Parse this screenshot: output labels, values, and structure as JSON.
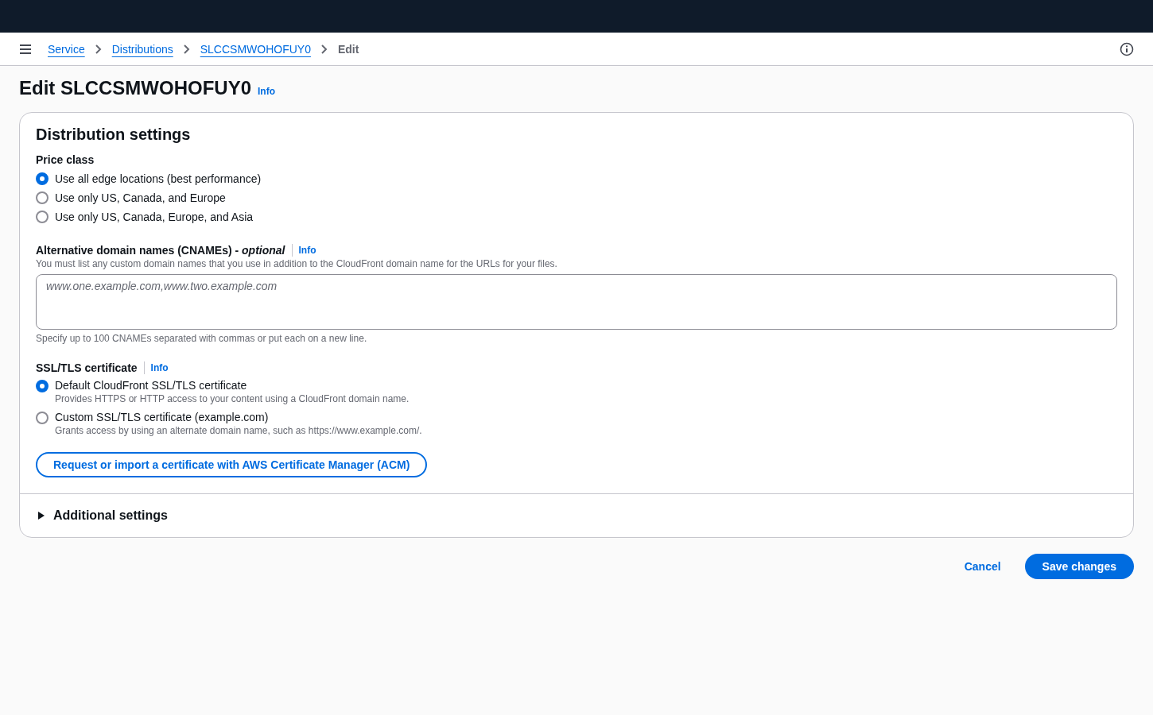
{
  "breadcrumbs": [
    {
      "label": "Service",
      "kind": "link"
    },
    {
      "label": "Distributions",
      "kind": "link"
    },
    {
      "label": "SLCCSMWOHOFUY0",
      "kind": "link"
    },
    {
      "label": "Edit",
      "kind": "current"
    }
  ],
  "page": {
    "title": "Edit SLCCSMWOHOFUY0",
    "info": "Info"
  },
  "panel": {
    "title": "Distribution settings",
    "price_class": {
      "label": "Price class",
      "options": [
        {
          "label": "Use all edge locations (best performance)",
          "selected": true
        },
        {
          "label": "Use only US, Canada, and Europe",
          "selected": false
        },
        {
          "label": "Use only US, Canada, Europe, and Asia",
          "selected": false
        }
      ]
    },
    "cnames": {
      "label": "Alternative domain names (CNAMEs) - *optional*",
      "info": "Info",
      "description": "You must list any custom domain names that you use in addition to the CloudFront domain name for the URLs for your files.",
      "placeholder": "www.one.example.com,www.two.example.com",
      "hint": "Specify up to 100 CNAMEs separated with commas or put each on a new line."
    },
    "certificate": {
      "label": "SSL/TLS certificate",
      "info": "Info",
      "options": [
        {
          "label": "Default CloudFront SSL/TLS certificate",
          "description": "Provides HTTPS or HTTP access to your content using a CloudFront domain name.",
          "selected": true
        },
        {
          "label": "Custom SSL/TLS certificate (example.com)",
          "description": "Grants access by using an alternate domain name, such as https://www.example.com/.",
          "selected": false
        }
      ],
      "button": "Request or import a certificate with AWS Certificate Manager (ACM)"
    },
    "additional": {
      "label": "Additional settings",
      "expanded": false
    }
  },
  "actions": {
    "cancel": "Cancel",
    "save": "Save changes"
  }
}
